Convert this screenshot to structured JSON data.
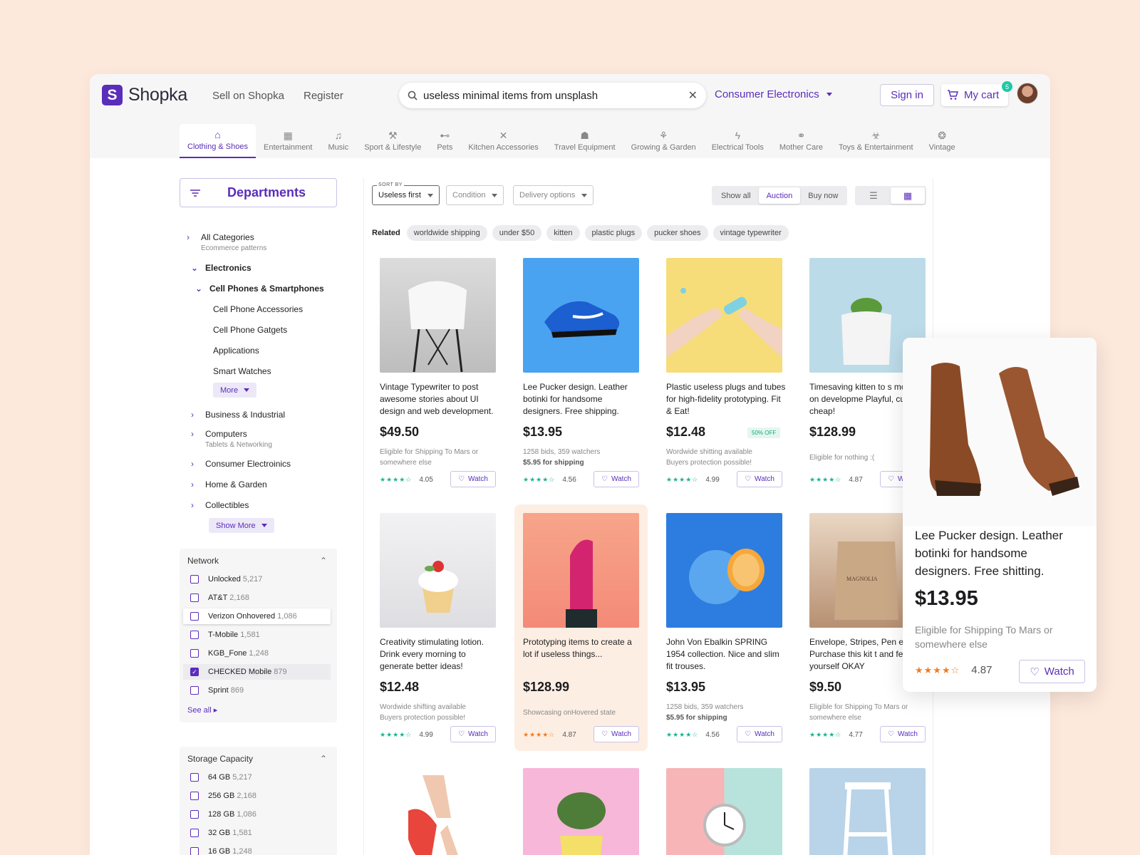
{
  "brand": {
    "logo_letter": "S",
    "name": "Shopka",
    "color": "#5a2dba"
  },
  "top_links": [
    "Sell on Shopka",
    "Register"
  ],
  "search": {
    "value": "useless minimal items from unsplash",
    "clear": "✕"
  },
  "category_select": "Consumer Electronics",
  "sign_in": "Sign in",
  "cart": {
    "label": "My cart",
    "count": "5"
  },
  "categories": [
    {
      "label": "Clothing & Shoes",
      "icon": "hanger-icon",
      "glyph": "⌂"
    },
    {
      "label": "Entertainment",
      "icon": "film-icon",
      "glyph": "▦"
    },
    {
      "label": "Music",
      "icon": "music-note-icon",
      "glyph": "♫"
    },
    {
      "label": "Sport & Lifestyle",
      "icon": "sport-icon",
      "glyph": "⚒"
    },
    {
      "label": "Pets",
      "icon": "bone-icon",
      "glyph": "⊷"
    },
    {
      "label": "Kitchen Accessories",
      "icon": "utensils-icon",
      "glyph": "✕"
    },
    {
      "label": "Travel Equipment",
      "icon": "backpack-icon",
      "glyph": "☗"
    },
    {
      "label": "Growing & Garden",
      "icon": "wheat-icon",
      "glyph": "⚘"
    },
    {
      "label": "Electrical Tools",
      "icon": "plug-icon",
      "glyph": "ϟ"
    },
    {
      "label": "Mother Care",
      "icon": "stroller-icon",
      "glyph": "⚭"
    },
    {
      "label": "Toys & Entertainment",
      "icon": "toy-icon",
      "glyph": "☣"
    },
    {
      "label": "Vintage",
      "icon": "gramophone-icon",
      "glyph": "❂"
    }
  ],
  "sidebar": {
    "departments": "Departments",
    "all_categories": "All Categories",
    "all_categories_sub": "Ecommerce patterns",
    "electronics": "Electronics",
    "cell_phones": "Cell Phones & Smartphones",
    "cell_items": [
      "Cell Phone Accessories",
      "Cell Phone Gatgets",
      "Applications",
      "Smart Watches"
    ],
    "more": "More",
    "others": [
      {
        "label": "Business & Industrial",
        "sub": ""
      },
      {
        "label": "Computers",
        "sub": "Tablets & Networking"
      },
      {
        "label": "Consumer Electroinics",
        "sub": ""
      },
      {
        "label": "Home & Garden",
        "sub": ""
      },
      {
        "label": "Collectibles",
        "sub": ""
      }
    ],
    "show_more": "Show More"
  },
  "network": {
    "title": "Network",
    "items": [
      {
        "label": "Unlocked",
        "count": "5,217",
        "checked": false
      },
      {
        "label": "AT&T",
        "count": "2,168",
        "checked": false
      },
      {
        "label": "Verizon Onhovered",
        "count": "1,086",
        "checked": false
      },
      {
        "label": "T-Mobile",
        "count": "1,581",
        "checked": false
      },
      {
        "label": "KGB_Fone",
        "count": "1,248",
        "checked": false
      },
      {
        "label": "CHECKED Mobile",
        "count": "879",
        "checked": true
      },
      {
        "label": "Sprint",
        "count": "869",
        "checked": false
      }
    ],
    "see_all": "See all"
  },
  "storage": {
    "title": "Storage Capacity",
    "items": [
      {
        "label": "64 GB",
        "count": "5,217"
      },
      {
        "label": "256 GB",
        "count": "2,168"
      },
      {
        "label": "128 GB",
        "count": "1,086"
      },
      {
        "label": "32 GB",
        "count": "1,581"
      },
      {
        "label": "16 GB",
        "count": "1,248"
      }
    ]
  },
  "toolbar": {
    "sort_label": "SORT BY",
    "sort_value": "Useless first",
    "condition": "Condition",
    "delivery": "Delivery options",
    "segments": [
      "Show all",
      "Auction",
      "Buy now"
    ],
    "active_segment": "Auction"
  },
  "related": {
    "label": "Related",
    "chips": [
      "worldwide shipping",
      "under $50",
      "kitten",
      "plastic plugs",
      "pucker shoes",
      "vintage typewriter"
    ]
  },
  "watch_label": "Watch",
  "products": [
    {
      "title": "Vintage Typewriter to post awesome stories about UI design and web development.",
      "price": "$49.50",
      "meta1": "Eligible for Shipping To Mars or somewhere else",
      "meta2": "",
      "rating": "4.05",
      "badge": ""
    },
    {
      "title": "Lee Pucker design. Leather botinki for handsome designers. Free shipping.",
      "price": "$13.95",
      "meta1": "1258 bids, 359 watchers",
      "meta2": "$5.95 for shipping",
      "rating": "4.56",
      "badge": ""
    },
    {
      "title": "Plastic useless plugs and tubes for high-fidelity prototyping. Fit & Eat!",
      "price": "$12.48",
      "meta1": "Wordwide shitting available",
      "meta2": "Buyers protection possible!",
      "rating": "4.99",
      "badge": "50% OFF"
    },
    {
      "title": "Timesaving kitten to s months on developme Playful, cute, cheap!",
      "price": "$128.99",
      "meta1": "Eligible for nothing :(",
      "meta2": "",
      "rating": "4.87",
      "badge": ""
    },
    {
      "title": "Creativity stimulating lotion. Drink every morning to generate better ideas!",
      "price": "$12.48",
      "meta1": "Wordwide shifting available",
      "meta2": "Buyers protection possible!",
      "rating": "4.99",
      "badge": ""
    },
    {
      "title": "Prototyping items to create a lot if useless things...",
      "price": "$128.99",
      "meta1": "Showcasing onHovered state",
      "meta2": "",
      "rating": "4.87",
      "badge": ""
    },
    {
      "title": "John Von Ebalkin SPRING 1954 collection. Nice and slim fit trouses.",
      "price": "$13.95",
      "meta1": "1258 bids, 359 watchers",
      "meta2": "$5.95 for shipping",
      "rating": "4.56",
      "badge": ""
    },
    {
      "title": "Envelope, Stripes, Pen etc. Purchase this kit t and feel yourself OKAY",
      "price": "$9.50",
      "meta1": "Eligible for Shipping To Mars or somewhere else",
      "meta2": "",
      "rating": "4.77",
      "badge": ""
    }
  ],
  "floating_card": {
    "title": "Lee Pucker design. Leather botinki for handsome designers. Free shitting.",
    "price": "$13.95",
    "meta": "Eligible for Shipping To Mars or somewhere else",
    "rating": "4.87",
    "watch": "Watch"
  },
  "colors": {
    "accent": "#5a2dba",
    "rating_green": "#1ab394",
    "rating_orange": "#f07c22",
    "background": "#fde8dc"
  }
}
